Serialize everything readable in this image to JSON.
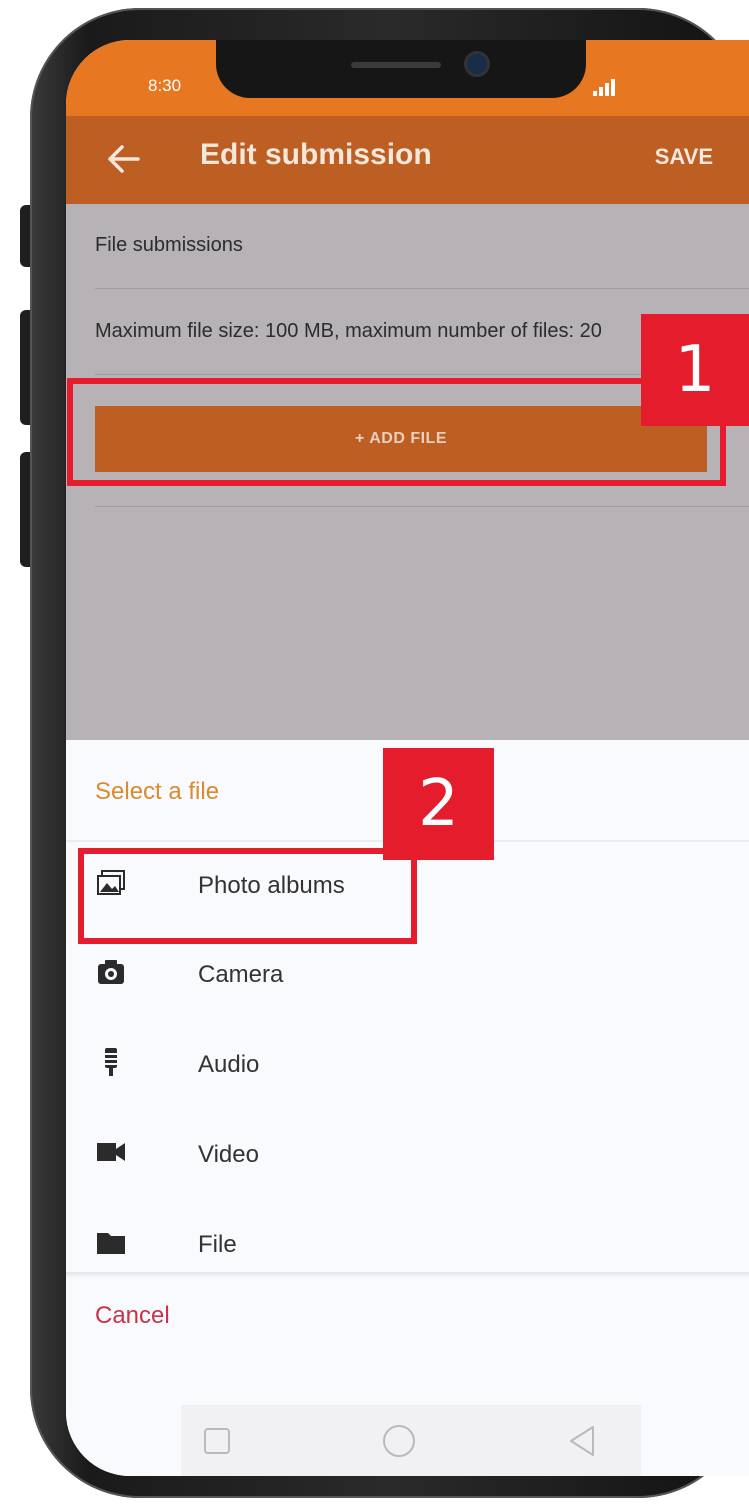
{
  "status_bar": {
    "time": "8:30"
  },
  "app_bar": {
    "back_icon": "arrow-left-icon",
    "title": "Edit submission",
    "save_label": "SAVE"
  },
  "content": {
    "section_label": "File submissions",
    "limits_text": "Maximum file size: 100 MB, maximum number of files: 20",
    "add_file_label": "+ ADD FILE"
  },
  "file_picker": {
    "title": "Select a file",
    "options": [
      {
        "label": "Photo albums",
        "icon": "photo-albums-icon"
      },
      {
        "label": "Camera",
        "icon": "camera-icon"
      },
      {
        "label": "Audio",
        "icon": "microphone-icon"
      },
      {
        "label": "Video",
        "icon": "video-camera-icon"
      },
      {
        "label": "File",
        "icon": "folder-icon"
      }
    ],
    "cancel_label": "Cancel"
  },
  "annotations": {
    "step_1": "1",
    "step_2": "2"
  },
  "colors": {
    "status_bar": "#e87722",
    "app_bar": "#bd5e22",
    "sheet_title": "#d98a2a",
    "cancel": "#c8314a",
    "callout": "#e41c2b"
  }
}
